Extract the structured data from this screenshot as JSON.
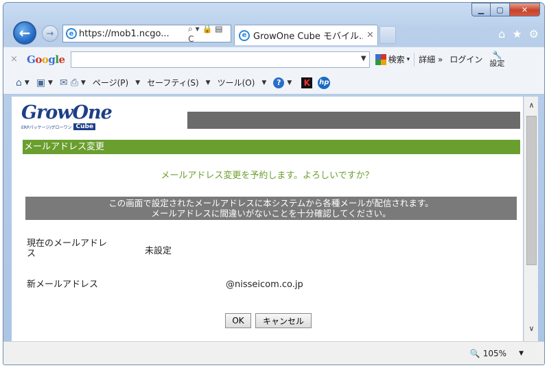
{
  "browser": {
    "address": "https://mob1.ncgo...",
    "tab_title": "GrowOne Cube モバイル...",
    "address_tools": "⌕ ▾ 🔒 ▤ C"
  },
  "google_toolbar": {
    "logo": [
      "G",
      "o",
      "o",
      "g",
      "l",
      "e"
    ],
    "search_label": "検索",
    "details_label": "詳細 »",
    "login_label": "ログイン",
    "settings_label": "設定"
  },
  "command_bar": {
    "page_menu": "ページ(P)",
    "safety_menu": "セーフティ(S)",
    "tools_menu": "ツール(O)"
  },
  "page": {
    "logo_main": "GrowOne",
    "logo_tagline": "ERPパッケージ/グローワン",
    "logo_cube": "Cube",
    "section_title": "メールアドレス変更",
    "confirm_message": "メールアドレス変更を予約します。よろしいですか？",
    "notice_line1": "この画面で設定されたメールアドレスに本システムから各種メールが配信されます。",
    "notice_line2": "メールアドレスに間違いがないことを十分確認してください。",
    "current_email_label": "現在のメールアドレス",
    "current_email_value": "未設定",
    "new_email_label": "新メールアドレス",
    "new_email_value": "@nisseicom.co.jp",
    "ok_label": "OK",
    "cancel_label": "キャンセル"
  },
  "status": {
    "zoom": "105%"
  },
  "colors": {
    "section_green": "#6a9e2e",
    "logo_navy": "#1d3f86",
    "notice_gray": "#7a7a7a",
    "header_gray": "#6b6b6b"
  },
  "icons": {
    "home": "home-icon",
    "star": "favorites-icon",
    "gear": "gear-icon"
  }
}
